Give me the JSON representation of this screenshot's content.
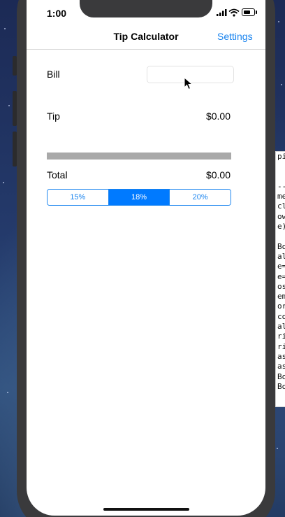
{
  "status_bar": {
    "time": "1:00"
  },
  "nav": {
    "title": "Tip Calculator",
    "settings_label": "Settings"
  },
  "form": {
    "bill_label": "Bill",
    "bill_value": "",
    "tip_label": "Tip",
    "tip_value": "$0.00",
    "total_label": "Total",
    "total_value": "$0.00"
  },
  "tip_options": {
    "options": [
      "15%",
      "18%",
      "20%"
    ],
    "selected": "18%"
  },
  "terminal_lines": [
    "pi",
    "",
    "",
    "--",
    "me",
    "cl",
    "ow",
    "e)",
    "",
    "Bo",
    "al",
    "e=",
    "e=",
    "os",
    "em",
    "or",
    "co",
    "al",
    "ri",
    "ri",
    "as",
    "as",
    "Bo",
    "Bo"
  ],
  "colors": {
    "accent": "#1a84ef",
    "segment_selected": "#007aff",
    "separator": "#a9a9a9"
  }
}
